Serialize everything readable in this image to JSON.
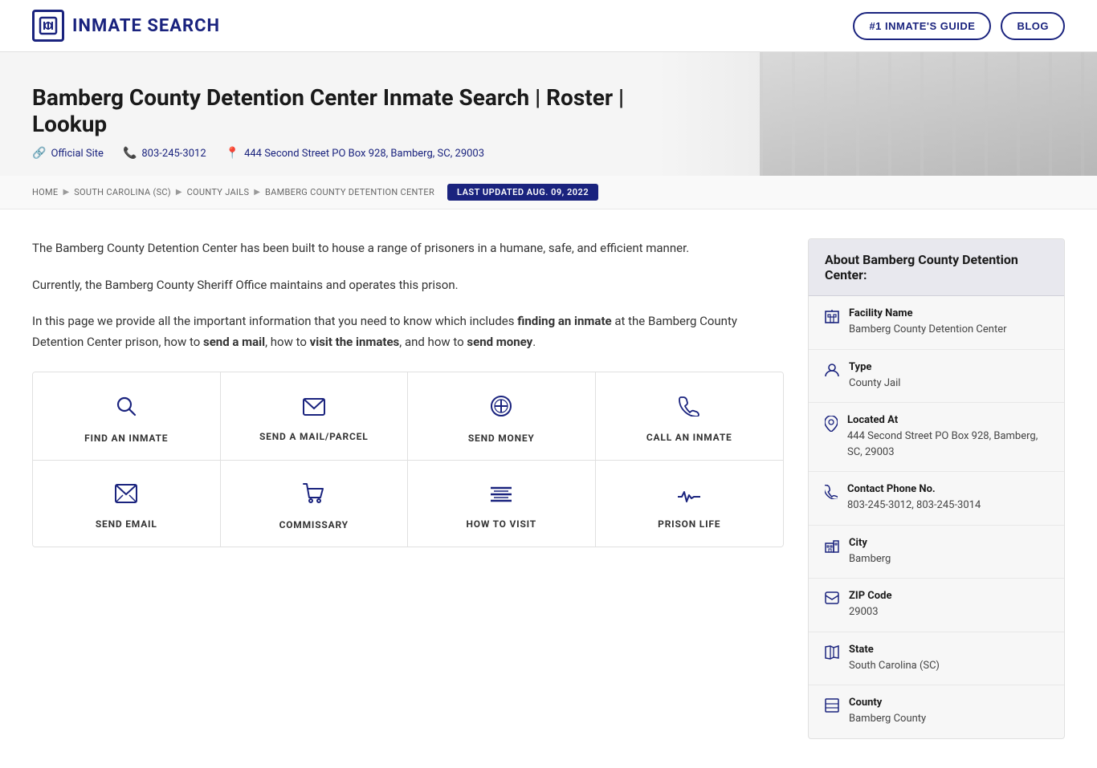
{
  "header": {
    "logo_icon": "⊞",
    "logo_text": "INMATE SEARCH",
    "nav": {
      "guide_label": "#1 INMATE'S GUIDE",
      "blog_label": "BLOG"
    }
  },
  "hero": {
    "page_title": "Bamberg County Detention Center Inmate Search | Roster | Lookup",
    "meta": {
      "official_site_label": "Official Site",
      "phone_label": "803-245-3012",
      "address_label": "444 Second Street PO Box 928, Bamberg, SC, 29003"
    }
  },
  "breadcrumb": {
    "items": [
      "HOME",
      "SOUTH CAROLINA (SC)",
      "COUNTY JAILS",
      "BAMBERG COUNTY DETENTION CENTER"
    ],
    "badge": "LAST UPDATED AUG. 09, 2022"
  },
  "main": {
    "paragraphs": [
      "The Bamberg County Detention Center has been built to house a range of prisoners in a humane, safe, and efficient manner.",
      "Currently, the Bamberg County Sheriff Office maintains and operates this prison.",
      "In this page we provide all the important information that you need to know which includes finding an inmate at the Bamberg County Detention Center prison, how to send a mail, how to visit the inmates, and how to send money."
    ],
    "paragraph3_parts": {
      "before_bold1": "In this page we provide all the important information that you need to know which includes ",
      "bold1": "finding an inmate",
      "between1_2": " at the Bamberg County Detention Center prison, how to ",
      "bold2": "send a mail",
      "between2_3": ", how to ",
      "bold3": "visit the inmates",
      "between3_4": ", and how to ",
      "bold4": "send money",
      "after_bold4": "."
    },
    "actions": [
      {
        "id": "find-inmate",
        "label": "FIND AN INMATE",
        "icon": "search"
      },
      {
        "id": "send-mail",
        "label": "SEND A MAIL/PARCEL",
        "icon": "mail"
      },
      {
        "id": "send-money",
        "label": "SEND MONEY",
        "icon": "money"
      },
      {
        "id": "call-inmate",
        "label": "CALL AN INMATE",
        "icon": "phone"
      },
      {
        "id": "send-email",
        "label": "SEND EMAIL",
        "icon": "email"
      },
      {
        "id": "commissary",
        "label": "COMMISSARY",
        "icon": "cart"
      },
      {
        "id": "how-to-visit",
        "label": "HOW TO VISIT",
        "icon": "list"
      },
      {
        "id": "prison-life",
        "label": "PRISON LIFE",
        "icon": "pulse"
      }
    ]
  },
  "sidebar": {
    "header": "About Bamberg County Detention Center:",
    "rows": [
      {
        "id": "facility-name",
        "icon": "building",
        "label": "Facility Name",
        "value": "Bamberg County Detention Center"
      },
      {
        "id": "type",
        "icon": "person",
        "label": "Type",
        "value": "County Jail"
      },
      {
        "id": "located-at",
        "icon": "pin",
        "label": "Located At",
        "value": "444 Second Street PO Box 928, Bamberg, SC, 29003"
      },
      {
        "id": "contact-phone",
        "icon": "phone",
        "label": "Contact Phone No.",
        "value": "803-245-3012, 803-245-3014"
      },
      {
        "id": "city",
        "icon": "city",
        "label": "City",
        "value": "Bamberg"
      },
      {
        "id": "zip",
        "icon": "mail",
        "label": "ZIP Code",
        "value": "29003"
      },
      {
        "id": "state",
        "icon": "map",
        "label": "State",
        "value": "South Carolina (SC)"
      },
      {
        "id": "county",
        "icon": "layer",
        "label": "County",
        "value": "Bamberg County"
      }
    ]
  }
}
